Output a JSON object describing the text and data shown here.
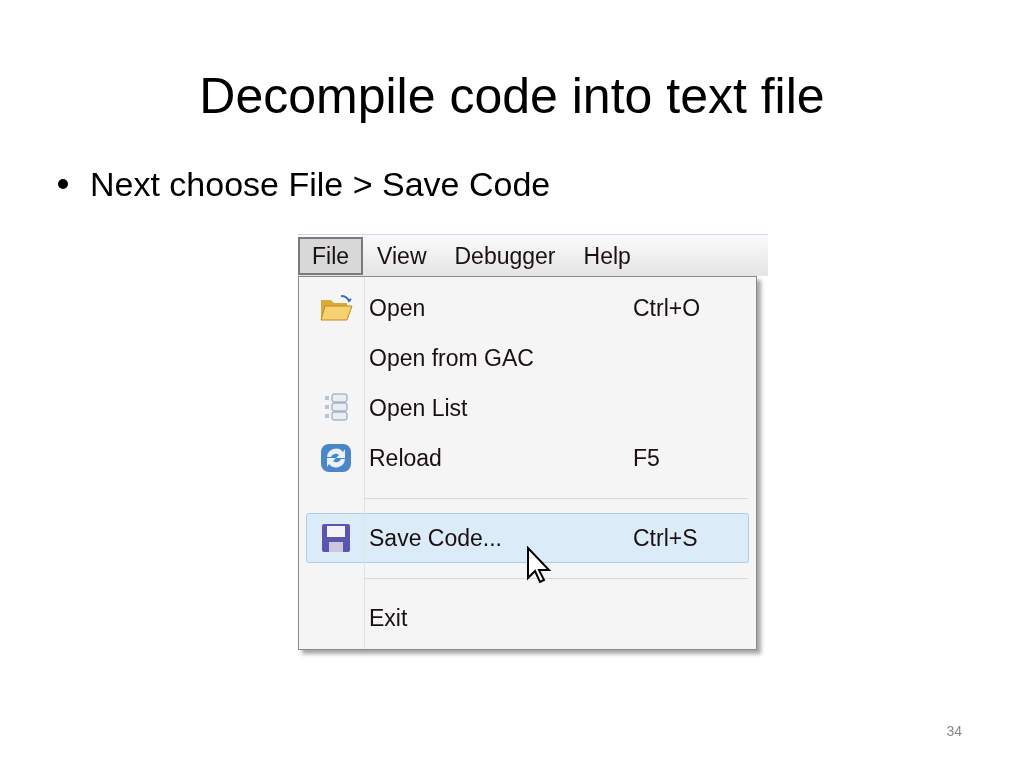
{
  "slide": {
    "title": "Decompile code into text file",
    "bullets": [
      "Next choose File > Save Code"
    ],
    "page_number": "34"
  },
  "menu_bar": [
    {
      "label": "File",
      "selected": true
    },
    {
      "label": "View",
      "selected": false
    },
    {
      "label": "Debugger",
      "selected": false
    },
    {
      "label": "Help",
      "selected": false
    }
  ],
  "menu": [
    {
      "kind": "item",
      "label": "Open",
      "shortcut": "Ctrl+O",
      "selected": false
    },
    {
      "kind": "item",
      "label": "Open from GAC",
      "selected": false
    },
    {
      "kind": "item",
      "label": "Open List",
      "selected": false
    },
    {
      "kind": "item",
      "label": "Reload",
      "shortcut": "F5",
      "selected": false
    },
    {
      "kind": "separator"
    },
    {
      "kind": "item",
      "label": "Save Code...",
      "shortcut": "Ctrl+S",
      "selected": true
    },
    {
      "kind": "separator"
    },
    {
      "kind": "item",
      "label": "Exit",
      "selected": false
    }
  ]
}
